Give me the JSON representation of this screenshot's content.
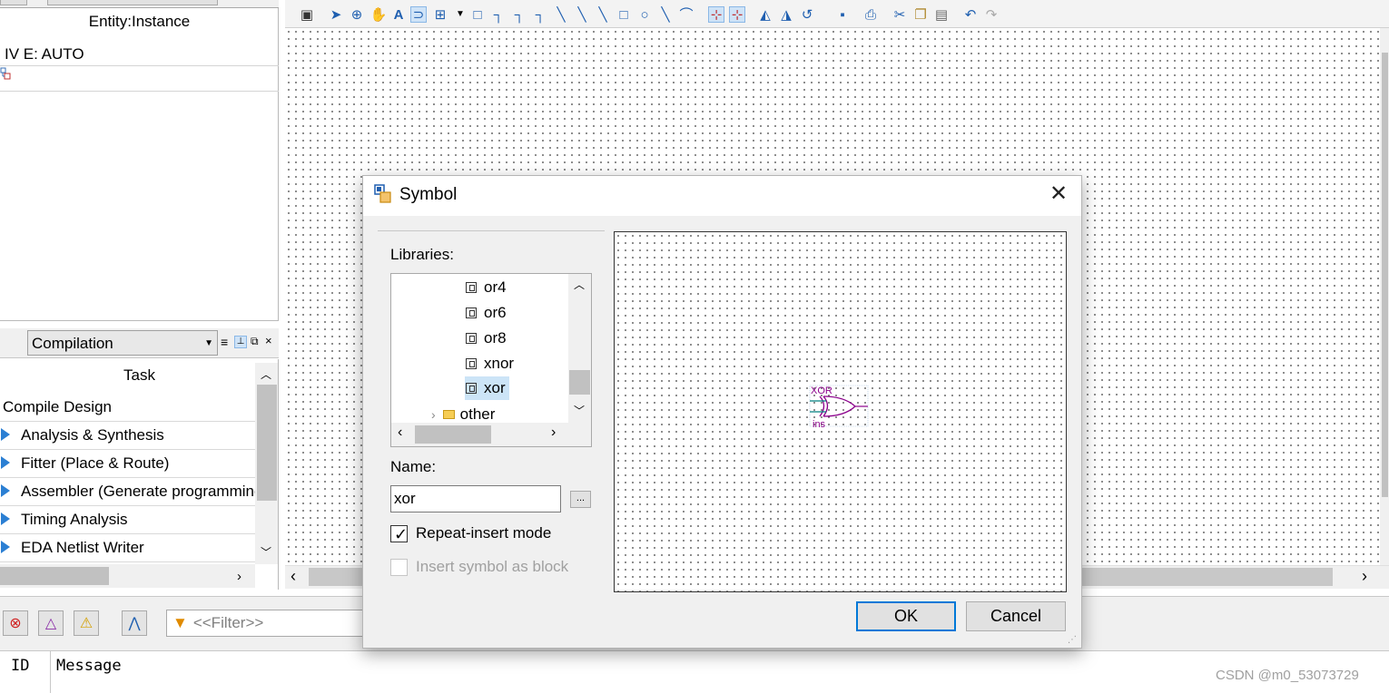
{
  "hierarchy": {
    "column_header": "Entity:Instance",
    "root_item": "IV E: AUTO"
  },
  "tasks": {
    "flow_selected": "Compilation",
    "column_header": "Task",
    "items": [
      {
        "label": "Compile Design",
        "expander": false
      },
      {
        "label": "Analysis & Synthesis",
        "expander": true
      },
      {
        "label": "Fitter (Place & Route)",
        "expander": true
      },
      {
        "label": "Assembler (Generate programming files)",
        "expander": true
      },
      {
        "label": "Timing Analysis",
        "expander": true
      },
      {
        "label": "EDA Netlist Writer",
        "expander": true
      }
    ]
  },
  "messages": {
    "filter_placeholder": "<<Filter>>",
    "columns": [
      "ID",
      "Message"
    ]
  },
  "dialog": {
    "title": "Symbol",
    "libraries_label": "Libraries:",
    "library_items": [
      {
        "label": "or4",
        "type": "symbol"
      },
      {
        "label": "or6",
        "type": "symbol"
      },
      {
        "label": "or8",
        "type": "symbol"
      },
      {
        "label": "xnor",
        "type": "symbol"
      },
      {
        "label": "xor",
        "type": "symbol",
        "selected": true
      },
      {
        "label": "other",
        "type": "folder"
      }
    ],
    "name_label": "Name:",
    "name_value": "xor",
    "browse_label": "...",
    "repeat_insert_label": "Repeat-insert mode",
    "repeat_insert_checked": true,
    "insert_as_block_label": "Insert symbol as block",
    "insert_as_block_checked": false,
    "preview": {
      "symbol_name": "XOR",
      "instance_name": "ins"
    },
    "ok_label": "OK",
    "cancel_label": "Cancel"
  },
  "watermark": "CSDN @m0_53073729",
  "colors": {
    "accent": "#0078d7",
    "task_arrow": "#2b7fd3",
    "symbol_magenta": "#8b008b",
    "symbol_teal": "#008080"
  }
}
